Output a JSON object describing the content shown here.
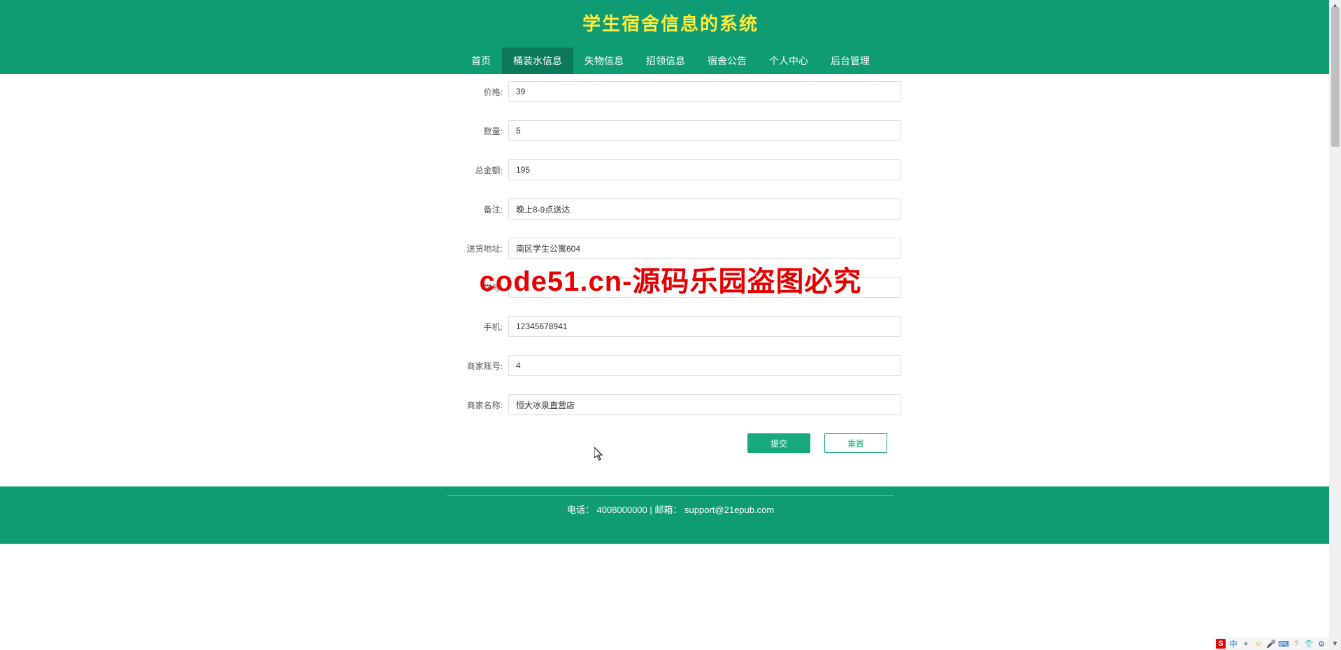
{
  "header": {
    "title": "学生宿舍信息的系统"
  },
  "nav": {
    "items": [
      {
        "label": "首页",
        "active": false
      },
      {
        "label": "桶装水信息",
        "active": true
      },
      {
        "label": "失物信息",
        "active": false
      },
      {
        "label": "招领信息",
        "active": false
      },
      {
        "label": "宿舍公告",
        "active": false
      },
      {
        "label": "个人中心",
        "active": false
      },
      {
        "label": "后台管理",
        "active": false
      }
    ]
  },
  "form": {
    "fields": [
      {
        "label": "价格:",
        "value": "39"
      },
      {
        "label": "数量:",
        "value": "5"
      },
      {
        "label": "总金额:",
        "value": "195"
      },
      {
        "label": "备注:",
        "value": "晚上8-9点送达"
      },
      {
        "label": "送货地址:",
        "value": "南区学生公寓604"
      },
      {
        "label": "学号:",
        "value": "1"
      },
      {
        "label": "手机:",
        "value": "12345678941"
      },
      {
        "label": "商家账号:",
        "value": "4"
      },
      {
        "label": "商家名称:",
        "value": "恒大冰泉直营店"
      }
    ],
    "submit_label": "提交",
    "reset_label": "重置"
  },
  "footer": {
    "phone_label": "电话：",
    "phone": "4008000000",
    "separator": " | ",
    "email_label": "邮箱：",
    "email": "support@21epub.com"
  },
  "watermark": {
    "text": "code51.cn",
    "center_text": "code51.cn-源码乐园盗图必究"
  },
  "tray": {
    "icons": [
      "S",
      "中",
      "●",
      "☺",
      "🎤",
      "⌨",
      "?",
      "👕",
      "⚙"
    ]
  }
}
